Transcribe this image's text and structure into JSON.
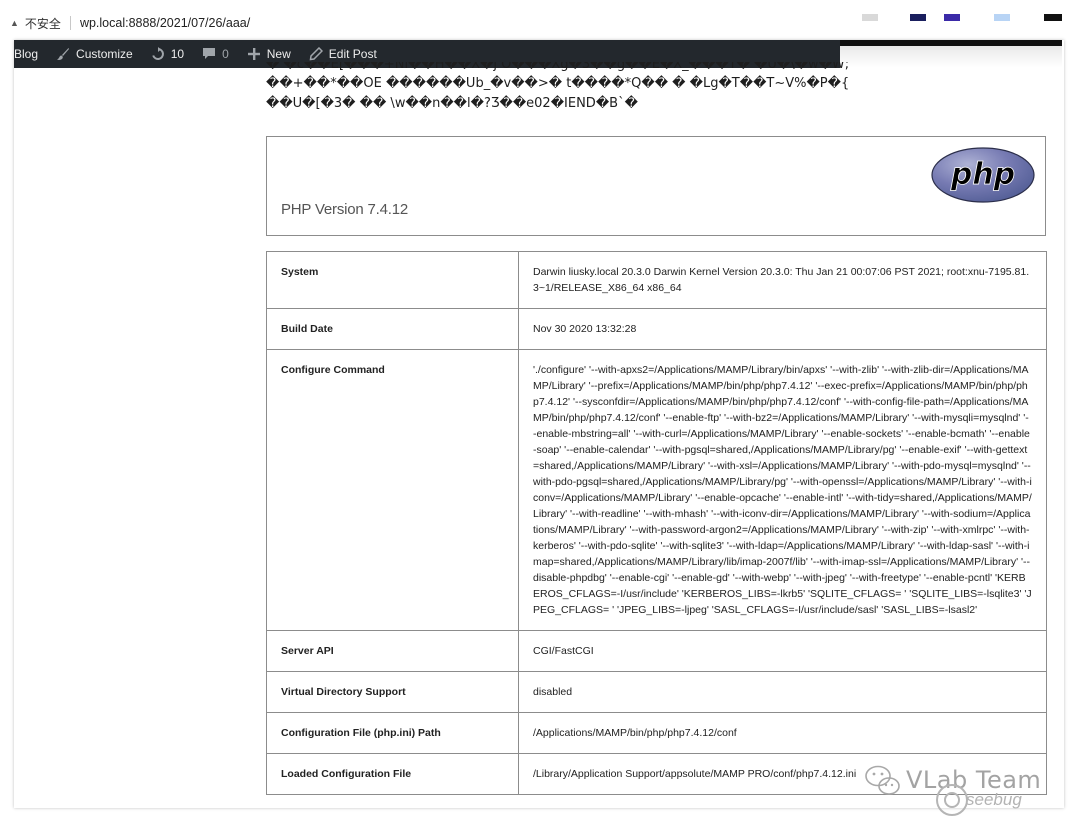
{
  "address_bar": {
    "security_label": "不安全",
    "url": "wp.local:8888/2021/07/26/aaa/"
  },
  "swatches": [
    {
      "color": "#d9d9d9"
    },
    {
      "color": "#1a1f5e"
    },
    {
      "color": "#3b2aa8"
    },
    {
      "color": "#b8d4f5"
    },
    {
      "color": "#111111"
    }
  ],
  "admin_bar": {
    "site_label": "Blog",
    "customize_label": "Customize",
    "updates_count": "10",
    "comments_count": "0",
    "new_label": "New",
    "edit_post_label": "Edit Post",
    "background_color": "#23282d"
  },
  "garbage_lines": [
    "� �c��E[���+Nl��H��X�j O���Xg�3��g��E�X_���T� �U�\\�w�W;",
    "��+��*��OE ������Ub_�v��>� t����*Q�� � �Lg�T��T~V%�P�{",
    "��U�[�3� �� \\w��n��l�?Ʒ��e02�IEND�B`�"
  ],
  "php_header": {
    "version": "PHP Version 7.4.12",
    "logo_text": "php"
  },
  "info_rows": [
    {
      "key": "System",
      "value": "Darwin liusky.local 20.3.0 Darwin Kernel Version 20.3.0: Thu Jan 21 00:07:06 PST 2021; root:xnu-7195.81.3~1/RELEASE_X86_64 x86_64"
    },
    {
      "key": "Build Date",
      "value": "Nov 30 2020 13:32:28"
    },
    {
      "key": "Configure Command",
      "value": "'./configure' '--with-apxs2=/Applications/MAMP/Library/bin/apxs' '--with-zlib' '--with-zlib-dir=/Applications/MAMP/Library' '--prefix=/Applications/MAMP/bin/php/php7.4.12' '--exec-prefix=/Applications/MAMP/bin/php/php7.4.12' '--sysconfdir=/Applications/MAMP/bin/php/php7.4.12/conf' '--with-config-file-path=/Applications/MAMP/bin/php/php7.4.12/conf' '--enable-ftp' '--with-bz2=/Applications/MAMP/Library' '--with-mysqli=mysqlnd' '--enable-mbstring=all' '--with-curl=/Applications/MAMP/Library' '--enable-sockets' '--enable-bcmath' '--enable-soap' '--enable-calendar' '--with-pgsql=shared,/Applications/MAMP/Library/pg' '--enable-exif' '--with-gettext=shared,/Applications/MAMP/Library' '--with-xsl=/Applications/MAMP/Library' '--with-pdo-mysql=mysqlnd' '--with-pdo-pgsql=shared,/Applications/MAMP/Library/pg' '--with-openssl=/Applications/MAMP/Library' '--with-iconv=/Applications/MAMP/Library' '--enable-opcache' '--enable-intl' '--with-tidy=shared,/Applications/MAMP/Library' '--with-readline' '--with-mhash' '--with-iconv-dir=/Applications/MAMP/Library' '--with-sodium=/Applications/MAMP/Library' '--with-password-argon2=/Applications/MAMP/Library' '--with-zip' '--with-xmlrpc' '--with-kerberos' '--with-pdo-sqlite' '--with-sqlite3' '--with-ldap=/Applications/MAMP/Library' '--with-ldap-sasl' '--with-imap=shared,/Applications/MAMP/Library/lib/imap-2007f/lib' '--with-imap-ssl=/Applications/MAMP/Library' '--disable-phpdbg' '--enable-cgi' '--enable-gd' '--with-webp' '--with-jpeg' '--with-freetype' '--enable-pcntl' 'KERBEROS_CFLAGS=-I/usr/include' 'KERBEROS_LIBS=-lkrb5' 'SQLITE_CFLAGS= ' 'SQLITE_LIBS=-lsqlite3' 'JPEG_CFLAGS= ' 'JPEG_LIBS=-ljpeg' 'SASL_CFLAGS=-I/usr/include/sasl' 'SASL_LIBS=-lsasl2'"
    },
    {
      "key": "Server API",
      "value": "CGI/FastCGI"
    },
    {
      "key": "Virtual Directory Support",
      "value": "disabled"
    },
    {
      "key": "Configuration File (php.ini) Path",
      "value": "/Applications/MAMP/bin/php/php7.4.12/conf"
    },
    {
      "key": "Loaded Configuration File",
      "value": "/Library/Application Support/appsolute/MAMP PRO/conf/php7.4.12.ini"
    }
  ],
  "watermark": {
    "title": "VLab Team",
    "subtitle": "seebug"
  }
}
